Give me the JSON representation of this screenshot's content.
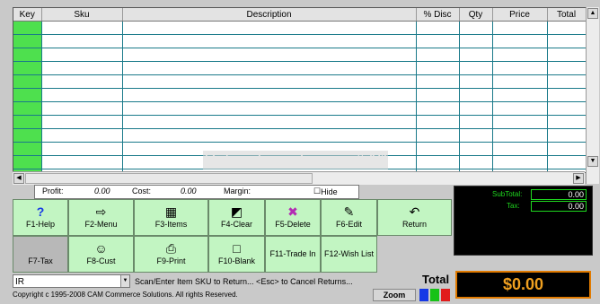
{
  "grid": {
    "columns": [
      "Key",
      "Sku",
      "Description",
      "% Disc",
      "Qty",
      "Price",
      "Total"
    ],
    "row_count": 12
  },
  "watermark": "Return From Invoice # 1$",
  "info": {
    "profit_label": "Profit:",
    "profit_value": "0.00",
    "cost_label": "Cost:",
    "cost_value": "0.00",
    "margin_label": "Margin:",
    "hide_label": "Hide"
  },
  "buttons": [
    {
      "label": "F1-Help",
      "icon": "?"
    },
    {
      "label": "F2-Menu",
      "icon": "⇨"
    },
    {
      "label": "F3-Items",
      "icon": "▦"
    },
    {
      "label": "F4-Clear",
      "icon": "◩"
    },
    {
      "label": "F5-Delete",
      "icon": "✖"
    },
    {
      "label": "F6-Edit",
      "icon": "✎"
    },
    {
      "label": "Return",
      "icon": "↶"
    },
    {
      "label": "F7-Tax",
      "icon": ""
    },
    {
      "label": "F8-Cust",
      "icon": "☺"
    },
    {
      "label": "F9-Print",
      "icon": "⎙"
    },
    {
      "label": "F10-Blank",
      "icon": "□"
    },
    {
      "label": "F11-Trade In",
      "icon": ""
    },
    {
      "label": "F12-Wish List",
      "icon": ""
    }
  ],
  "totals": {
    "subtotal_label": "SubTotal:",
    "subtotal_value": "0.00",
    "tax_label": "Tax:",
    "tax_value": "0.00",
    "total_label": "Total",
    "total_value": "$0.00"
  },
  "combo_value": "IR",
  "status_text": "Scan/Enter Item SKU to Return... <Esc> to Cancel Returns...",
  "copyright": "Copyright c 1995-2008 CAM Commerce Solutions. All rights Reserved.",
  "zoom_label": "Zoom",
  "colors": {
    "key_col": "#4ee04e",
    "button_bg": "#c2f5c2",
    "total_border": "#e07a00",
    "swatch_blue": "#1538e6",
    "swatch_green": "#17c217",
    "swatch_red": "#e11c1c"
  }
}
